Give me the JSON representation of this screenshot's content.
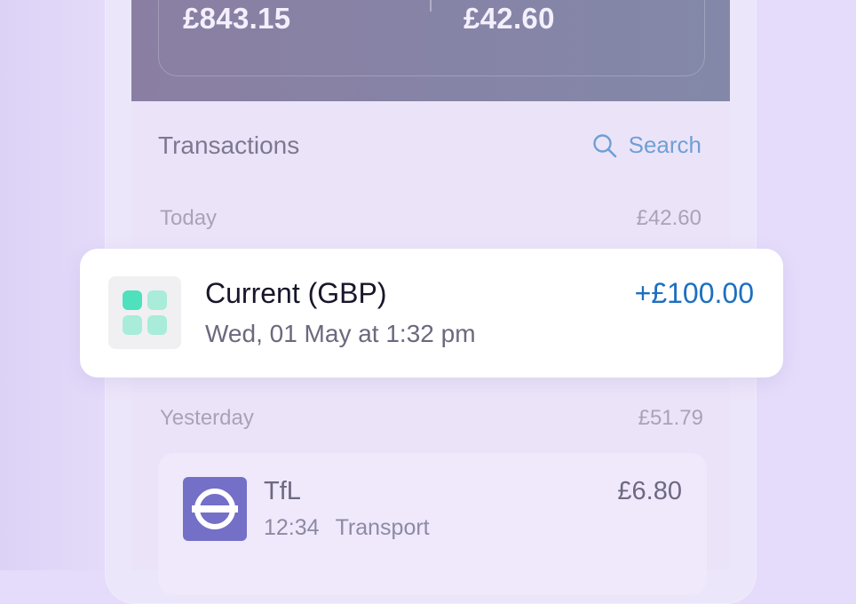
{
  "balances": {
    "left": "£843.15",
    "right": "£42.60"
  },
  "transactions_header": {
    "title": "Transactions",
    "search_label": "Search"
  },
  "groups": [
    {
      "label": "Today",
      "total": "£42.60"
    },
    {
      "label": "Yesterday",
      "total": "£51.79"
    }
  ],
  "highlight_transaction": {
    "title": "Current (GBP)",
    "subtitle": "Wed, 01 May at 1:32 pm",
    "amount": "+£100.00",
    "icon": "grid-icon"
  },
  "transactions": [
    {
      "merchant": "TfL",
      "time": "12:34",
      "category": "Transport",
      "amount": "£6.80",
      "icon": "tfl-roundel-icon"
    }
  ],
  "colors": {
    "accent_blue": "#1d6fc0",
    "search_blue": "#6f9fd6",
    "tfl_purple": "#7470c8",
    "grid_green_dark": "#4fe0be",
    "grid_green_light": "#a8ecd9"
  }
}
